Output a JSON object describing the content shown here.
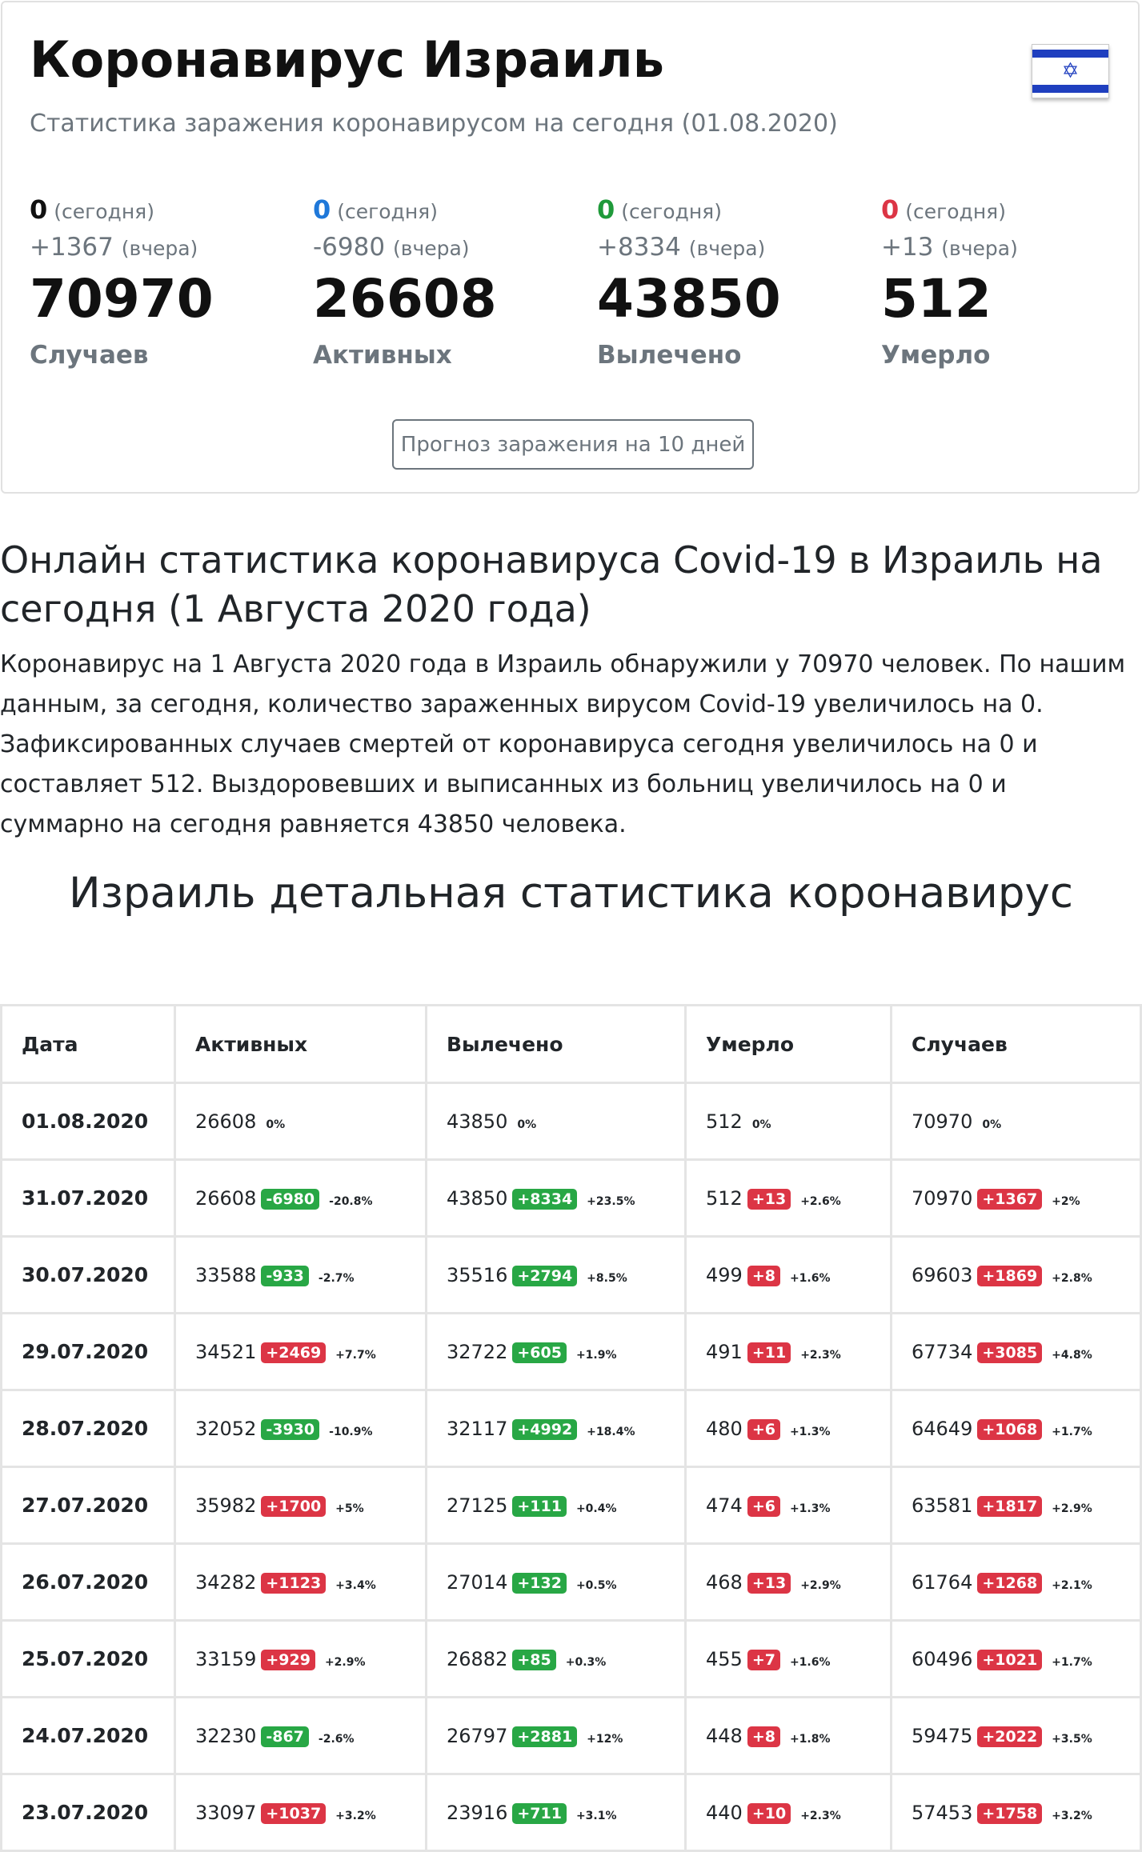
{
  "header": {
    "title": "Коронавирус Израиль",
    "subtitle": "Статистика заражения коронавирусом на сегодня (01.08.2020)",
    "flag_icon": "israel-flag-icon"
  },
  "stats": [
    {
      "today_value": "0",
      "today_label": "(сегодня)",
      "yesterday_value": "+1367",
      "yesterday_label": "(вчера)",
      "total": "70970",
      "label": "Случаев",
      "color": "#111111"
    },
    {
      "today_value": "0",
      "today_label": "(сегодня)",
      "yesterday_value": "-6980",
      "yesterday_label": "(вчера)",
      "total": "26608",
      "label": "Активных",
      "color": "#1f78d9"
    },
    {
      "today_value": "0",
      "today_label": "(сегодня)",
      "yesterday_value": "+8334",
      "yesterday_label": "(вчера)",
      "total": "43850",
      "label": "Вылечено",
      "color": "#1f9a3a"
    },
    {
      "today_value": "0",
      "today_label": "(сегодня)",
      "yesterday_value": "+13",
      "yesterday_label": "(вчера)",
      "total": "512",
      "label": "Умерло",
      "color": "#dc3545"
    }
  ],
  "forecast_button": "Прогноз заражения на 10 дней",
  "online": {
    "heading": "Онлайн статистика коронавируса Covid-19 в Израиль на сегодня (1 Августа 2020 года)",
    "paragraph": "Коронавирус на 1 Августа 2020 года в Израиль обнаружили у 70970 человек. По нашим данным, за сегодня, количество зараженных вирусом Covid-19 увеличилось на 0. Зафиксированных случаев смертей от коронавируса сегодня увеличилось на 0 и составляет 512. Выздоровевших и выписанных из больниц увеличилось на 0 и суммарно на сегодня равняется 43850 человека."
  },
  "detail_heading": "Израиль детальная статистика коронавирус",
  "table": {
    "headers": [
      "Дата",
      "Активных",
      "Вылечено",
      "Умерло",
      "Случаев"
    ],
    "colors": {
      "up": "#dc3545",
      "down": "#28a745"
    },
    "rows": [
      {
        "date": "01.08.2020",
        "cells": [
          {
            "value": "26608",
            "delta": "",
            "pct": "0%",
            "color": ""
          },
          {
            "value": "43850",
            "delta": "",
            "pct": "0%",
            "color": ""
          },
          {
            "value": "512",
            "delta": "",
            "pct": "0%",
            "color": ""
          },
          {
            "value": "70970",
            "delta": "",
            "pct": "0%",
            "color": ""
          }
        ]
      },
      {
        "date": "31.07.2020",
        "cells": [
          {
            "value": "26608",
            "delta": "-6980",
            "pct": "-20.8%",
            "color": "green"
          },
          {
            "value": "43850",
            "delta": "+8334",
            "pct": "+23.5%",
            "color": "green"
          },
          {
            "value": "512",
            "delta": "+13",
            "pct": "+2.6%",
            "color": "red"
          },
          {
            "value": "70970",
            "delta": "+1367",
            "pct": "+2%",
            "color": "red"
          }
        ]
      },
      {
        "date": "30.07.2020",
        "cells": [
          {
            "value": "33588",
            "delta": "-933",
            "pct": "-2.7%",
            "color": "green"
          },
          {
            "value": "35516",
            "delta": "+2794",
            "pct": "+8.5%",
            "color": "green"
          },
          {
            "value": "499",
            "delta": "+8",
            "pct": "+1.6%",
            "color": "red"
          },
          {
            "value": "69603",
            "delta": "+1869",
            "pct": "+2.8%",
            "color": "red"
          }
        ]
      },
      {
        "date": "29.07.2020",
        "cells": [
          {
            "value": "34521",
            "delta": "+2469",
            "pct": "+7.7%",
            "color": "red"
          },
          {
            "value": "32722",
            "delta": "+605",
            "pct": "+1.9%",
            "color": "green"
          },
          {
            "value": "491",
            "delta": "+11",
            "pct": "+2.3%",
            "color": "red"
          },
          {
            "value": "67734",
            "delta": "+3085",
            "pct": "+4.8%",
            "color": "red"
          }
        ]
      },
      {
        "date": "28.07.2020",
        "cells": [
          {
            "value": "32052",
            "delta": "-3930",
            "pct": "-10.9%",
            "color": "green"
          },
          {
            "value": "32117",
            "delta": "+4992",
            "pct": "+18.4%",
            "color": "green"
          },
          {
            "value": "480",
            "delta": "+6",
            "pct": "+1.3%",
            "color": "red"
          },
          {
            "value": "64649",
            "delta": "+1068",
            "pct": "+1.7%",
            "color": "red"
          }
        ]
      },
      {
        "date": "27.07.2020",
        "cells": [
          {
            "value": "35982",
            "delta": "+1700",
            "pct": "+5%",
            "color": "red"
          },
          {
            "value": "27125",
            "delta": "+111",
            "pct": "+0.4%",
            "color": "green"
          },
          {
            "value": "474",
            "delta": "+6",
            "pct": "+1.3%",
            "color": "red"
          },
          {
            "value": "63581",
            "delta": "+1817",
            "pct": "+2.9%",
            "color": "red"
          }
        ]
      },
      {
        "date": "26.07.2020",
        "cells": [
          {
            "value": "34282",
            "delta": "+1123",
            "pct": "+3.4%",
            "color": "red"
          },
          {
            "value": "27014",
            "delta": "+132",
            "pct": "+0.5%",
            "color": "green"
          },
          {
            "value": "468",
            "delta": "+13",
            "pct": "+2.9%",
            "color": "red"
          },
          {
            "value": "61764",
            "delta": "+1268",
            "pct": "+2.1%",
            "color": "red"
          }
        ]
      },
      {
        "date": "25.07.2020",
        "cells": [
          {
            "value": "33159",
            "delta": "+929",
            "pct": "+2.9%",
            "color": "red"
          },
          {
            "value": "26882",
            "delta": "+85",
            "pct": "+0.3%",
            "color": "green"
          },
          {
            "value": "455",
            "delta": "+7",
            "pct": "+1.6%",
            "color": "red"
          },
          {
            "value": "60496",
            "delta": "+1021",
            "pct": "+1.7%",
            "color": "red"
          }
        ]
      },
      {
        "date": "24.07.2020",
        "cells": [
          {
            "value": "32230",
            "delta": "-867",
            "pct": "-2.6%",
            "color": "green"
          },
          {
            "value": "26797",
            "delta": "+2881",
            "pct": "+12%",
            "color": "green"
          },
          {
            "value": "448",
            "delta": "+8",
            "pct": "+1.8%",
            "color": "red"
          },
          {
            "value": "59475",
            "delta": "+2022",
            "pct": "+3.5%",
            "color": "red"
          }
        ]
      },
      {
        "date": "23.07.2020",
        "cells": [
          {
            "value": "33097",
            "delta": "+1037",
            "pct": "+3.2%",
            "color": "red"
          },
          {
            "value": "23916",
            "delta": "+711",
            "pct": "+3.1%",
            "color": "green"
          },
          {
            "value": "440",
            "delta": "+10",
            "pct": "+2.3%",
            "color": "red"
          },
          {
            "value": "57453",
            "delta": "+1758",
            "pct": "+3.2%",
            "color": "red"
          }
        ]
      }
    ]
  }
}
